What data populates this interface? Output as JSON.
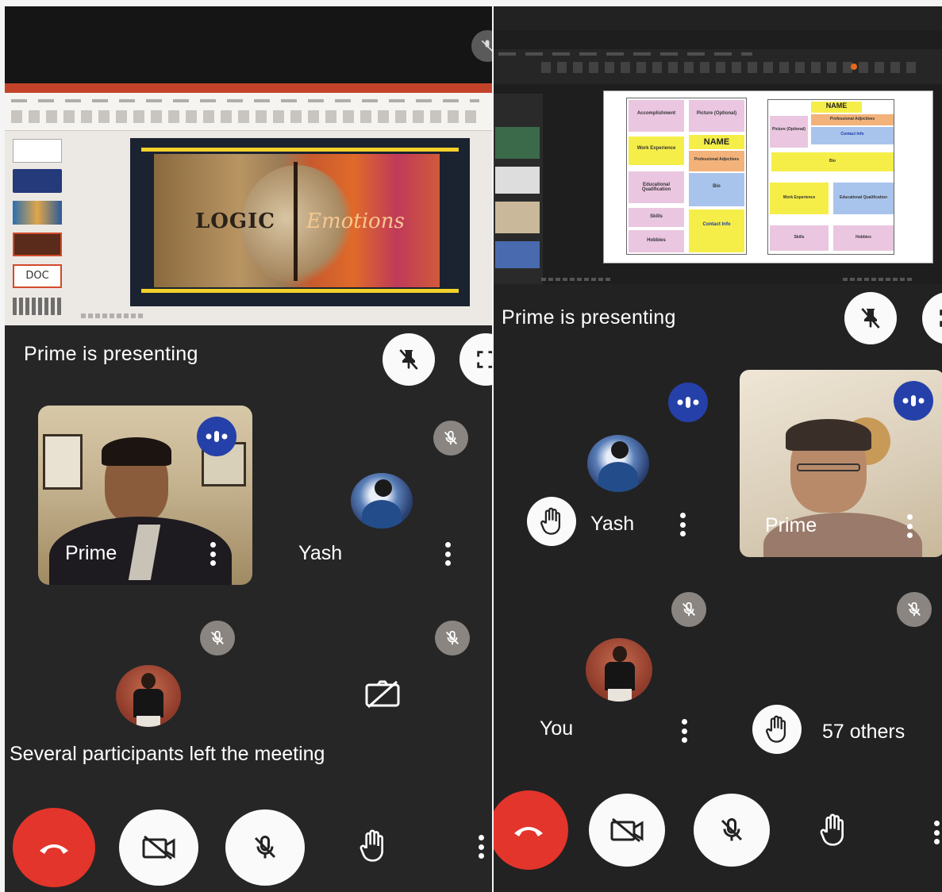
{
  "left": {
    "slide": {
      "title_left": "LOGIC",
      "title_right": "Emotions",
      "thumb_label": "DOC"
    },
    "presenting_text": "Prime is presenting",
    "tiles": [
      {
        "name": "Prime"
      },
      {
        "name": "Yash"
      }
    ],
    "toast": "Several participants left the meeting"
  },
  "right": {
    "slide": {
      "left_cards": [
        "Accomplishment",
        "Picture (Optional)",
        "Work Experience",
        "NAME",
        "Educational Qualification",
        "Professional Adjectives",
        "Skills",
        "Bio",
        "Hobbies",
        "Contact Info"
      ],
      "right_name": "NAME",
      "right_cards": [
        "Picture (Optional)",
        "Professional Adjectives",
        "Contact Info",
        "Bio",
        "Work Experience",
        "Educational Qualification",
        "Skills",
        "Hobbies"
      ]
    },
    "presenting_text": "Prime is presenting",
    "tiles": [
      {
        "name": "Yash"
      },
      {
        "name": "Prime"
      },
      {
        "name": "You"
      },
      {
        "name": "57 others"
      }
    ]
  },
  "colors": {
    "end_call": "#e3352b",
    "talking": "#2540a8",
    "panel_bg": "#262626"
  }
}
